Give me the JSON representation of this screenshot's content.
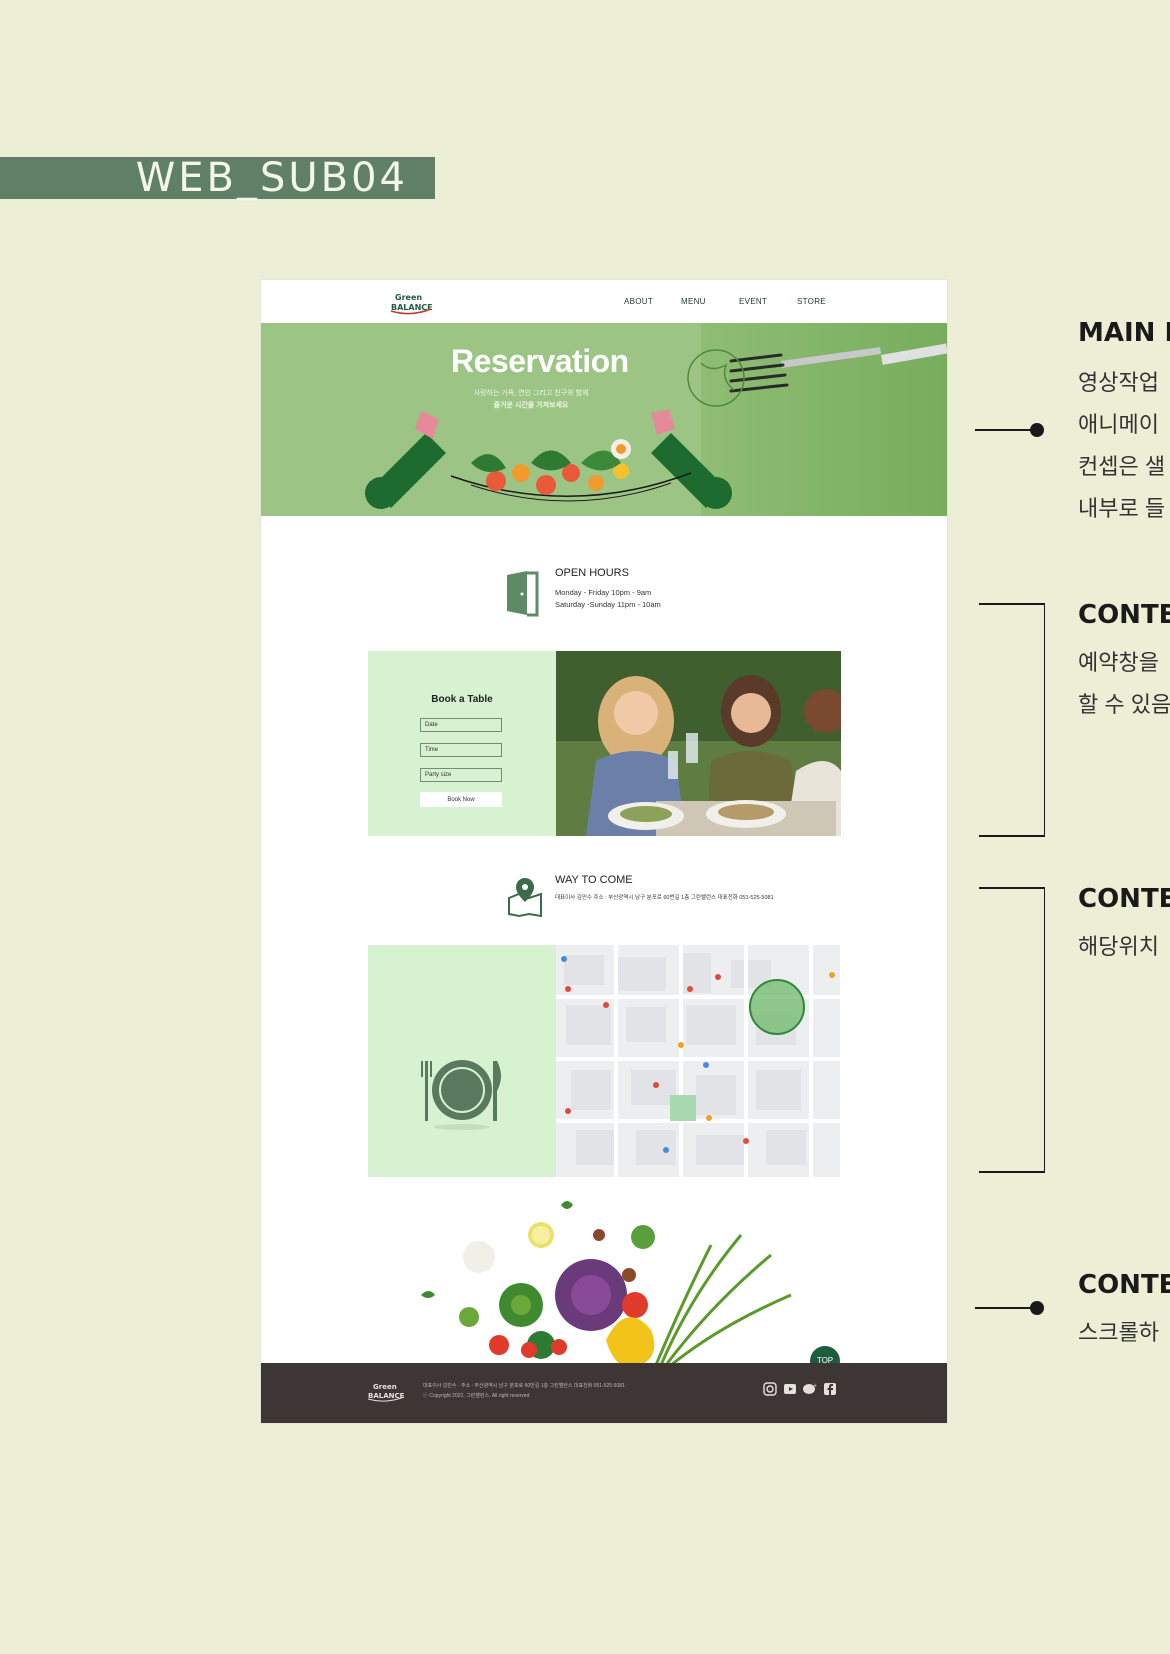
{
  "page_tag": "WEB_SUB04",
  "header": {
    "logo_text": "Green Balance",
    "nav": [
      "ABOUT",
      "MENU",
      "EVENT",
      "STORE"
    ]
  },
  "hero": {
    "title": "Reservation",
    "subtitle_line1": "사랑하는 가족, 연인 그리고 친구와 함께",
    "subtitle_line2": "즐거운 시간을 가져보세요"
  },
  "open_hours": {
    "title": "OPEN HOURS",
    "lines": [
      "Monday - Friday  10pm - 9am",
      "Saturday -Sunday 11pm - 10am"
    ]
  },
  "booking": {
    "title": "Book a Table",
    "fields": [
      "Date",
      "Time",
      "Party size"
    ],
    "button": "Book Now"
  },
  "way_to_come": {
    "title": "WAY TO COME",
    "address": "대표이사 김민수   주소 : 부산광역시 남구 분포로 60번길 1층 그린밸런스 대표전화 051-525-5081"
  },
  "top_button": "TOP",
  "footer": {
    "logo_text": "Green Balance",
    "line1": "대표이사 김민수 · 주소 : 부산광역시 남구 분포로 60번길 1층 그린밸런스 대표전화 051-525-5081",
    "line2": "ⓒ Copyright 2022, 그린밸런스. All right reserved",
    "social_icons": [
      "instagram-icon",
      "youtube-icon",
      "kakao-icon",
      "facebook-icon"
    ]
  },
  "annotations": [
    {
      "title": "MAIN I",
      "lines": [
        "영상작업",
        "애니메이",
        "컨셉은 샐",
        "내부로 들"
      ]
    },
    {
      "title": "CONTE",
      "lines": [
        "예약창을",
        "할 수 있음"
      ]
    },
    {
      "title": "CONTE",
      "lines": [
        "해당위치"
      ]
    },
    {
      "title": "CONTE",
      "lines": [
        "스크롤하"
      ]
    }
  ],
  "colors": {
    "background": "#ecefd5",
    "tag": "#5f7f66",
    "hero_green": "#9cc585",
    "panel_green": "#d7f2d0",
    "footer": "#3e3535",
    "accent": "#1e5c3f"
  }
}
